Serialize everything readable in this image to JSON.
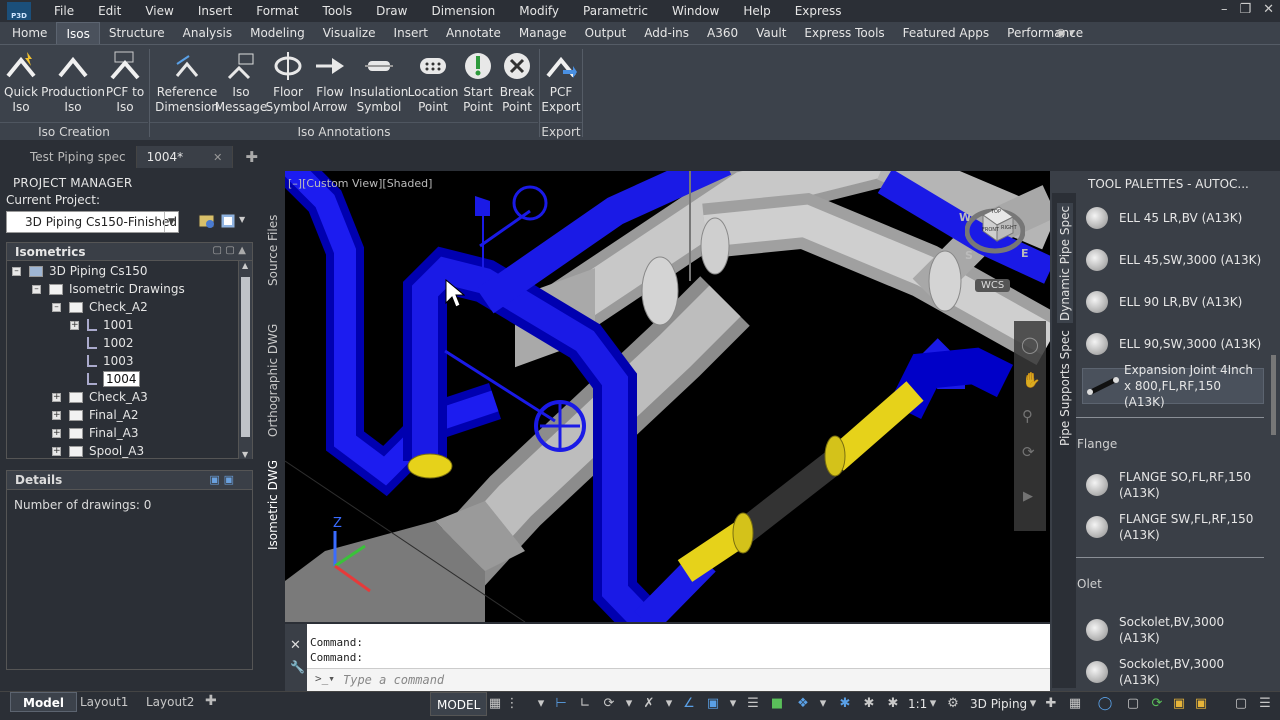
{
  "menubar": {
    "app_logo_text": "P3D",
    "items": [
      "File",
      "Edit",
      "View",
      "Insert",
      "Format",
      "Tools",
      "Draw",
      "Dimension",
      "Modify",
      "Parametric",
      "Window",
      "Help",
      "Express"
    ]
  },
  "ribbon_tabs": [
    "Home",
    "Isos",
    "Structure",
    "Analysis",
    "Modeling",
    "Visualize",
    "Insert",
    "Annotate",
    "Manage",
    "Output",
    "Add-ins",
    "A360",
    "Vault",
    "Express Tools",
    "Featured Apps",
    "Performance"
  ],
  "ribbon_active_tab": "Isos",
  "ribbon": {
    "iso_creation": {
      "title": "Iso Creation",
      "buttons": [
        {
          "line1": "Quick",
          "line2": "Iso"
        },
        {
          "line1": "Production",
          "line2": "Iso"
        },
        {
          "line1": "PCF to",
          "line2": "Iso"
        }
      ]
    },
    "iso_annotations": {
      "title": "Iso Annotations",
      "buttons": [
        {
          "line1": "Reference",
          "line2": "Dimension"
        },
        {
          "line1": "Iso",
          "line2": "Message"
        },
        {
          "line1": "Floor",
          "line2": "Symbol"
        },
        {
          "line1": "Flow",
          "line2": "Arrow"
        },
        {
          "line1": "Insulation",
          "line2": "Symbol"
        },
        {
          "line1": "Location",
          "line2": "Point"
        },
        {
          "line1": "Start",
          "line2": "Point"
        },
        {
          "line1": "Break",
          "line2": "Point"
        }
      ]
    },
    "export": {
      "title": "Export",
      "buttons": [
        {
          "line1": "PCF",
          "line2": "Export"
        }
      ],
      "pcf_icon_text": "PCF"
    }
  },
  "file_tabs": [
    {
      "label": "Test Piping spec"
    },
    {
      "label": "1004*"
    }
  ],
  "project_manager": {
    "title": "PROJECT MANAGER",
    "current_project_label": "Current Project:",
    "current_project_value": "3D Piping Cs150-Finished",
    "isometrics_header": "Isometrics",
    "tree": [
      {
        "label": "3D Piping Cs150"
      },
      {
        "label": "Isometric Drawings"
      },
      {
        "label": "Check_A2"
      },
      {
        "label": "1001"
      },
      {
        "label": "1002"
      },
      {
        "label": "1003"
      },
      {
        "label": "1004"
      },
      {
        "label": "Check_A3"
      },
      {
        "label": "Final_A2"
      },
      {
        "label": "Final_A3"
      },
      {
        "label": "Spool_A3"
      }
    ],
    "details_header": "Details",
    "details_text": "Number of drawings: 0"
  },
  "side_tabs": [
    "Source Files",
    "Orthographic DWG",
    "Isometric DWG"
  ],
  "viewport": {
    "label": "[–][Custom View][Shaded]",
    "viewcube_top": "TOP",
    "viewcube_front": "FRONT",
    "viewcube_right": "RIGHT",
    "compass_w": "W",
    "compass_s": "S",
    "compass_e": "E",
    "wcs": "WCS",
    "axis_z": "Z"
  },
  "command": {
    "line1": "Command:",
    "line2": "Command:",
    "placeholder": "Type a command"
  },
  "tool_palettes": {
    "title": "TOOL PALETTES - AUTOC...",
    "tabs": [
      "Dynamic Pipe Spec",
      "Pipe Supports Spec"
    ],
    "items_top": [
      {
        "label": "ELL 45 LR,BV (A13K)"
      },
      {
        "label": "ELL 45,SW,3000 (A13K)"
      },
      {
        "label": "ELL 90 LR,BV (A13K)"
      },
      {
        "label": "ELL 90,SW,3000 (A13K)"
      },
      {
        "label": "Expansion Joint 4Inch x 800,FL,RF,150 (A13K)"
      }
    ],
    "section_flange": "Flange",
    "items_flange": [
      {
        "label": "FLANGE SO,FL,RF,150 (A13K)"
      },
      {
        "label": "FLANGE SW,FL,RF,150 (A13K)"
      }
    ],
    "section_olet": "Olet",
    "items_olet": [
      {
        "label": "Sockolet,BV,3000 (A13K)"
      },
      {
        "label": "Sockolet,BV,3000 (A13K)"
      }
    ]
  },
  "status_bar": {
    "layout_tabs": [
      "Model",
      "Layout1",
      "Layout2"
    ],
    "model_button": "MODEL",
    "scale": "1:1",
    "workspace": "3D Piping"
  },
  "colors": {
    "pipe_blue": "#1a1ae6",
    "pipe_gray": "#b9b9b9",
    "pipe_yellow": "#e6d21a",
    "ui_dark": "#2b2f36",
    "ui_panel": "#3c424b"
  }
}
